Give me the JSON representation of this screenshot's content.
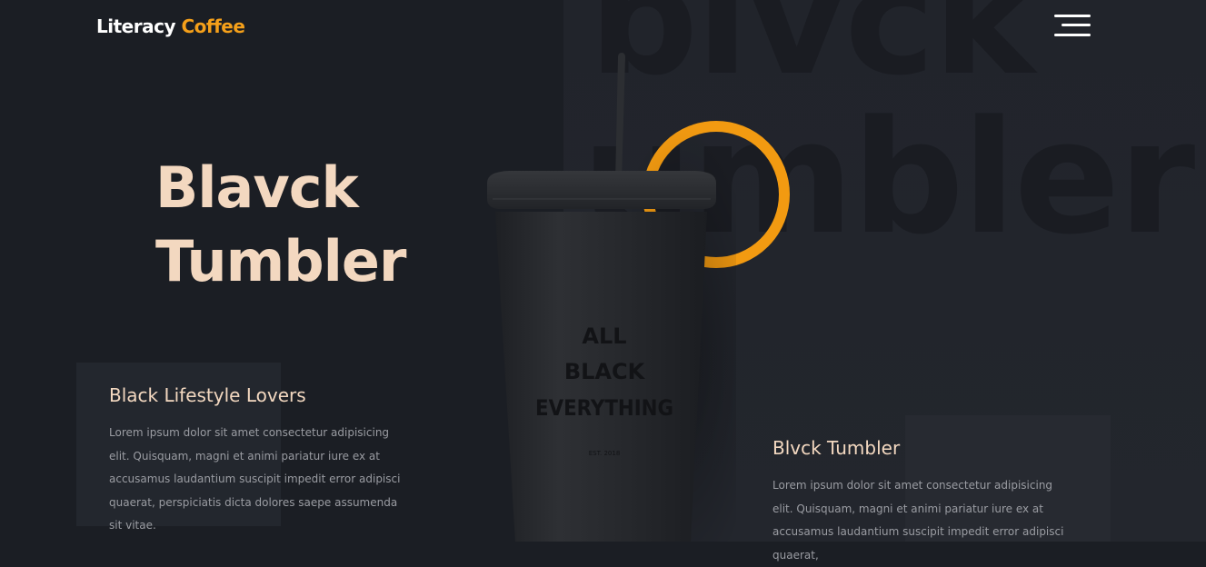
{
  "header": {
    "logo_main": "Literacy",
    "logo_accent": "Coffee"
  },
  "hero": {
    "title_line1": "Blavck",
    "title_line2": "Tumbler",
    "bg_word_line1": "blvck",
    "bg_word_line2": "umbler"
  },
  "product": {
    "print_line1": "ALL",
    "print_line2": "BLACK",
    "print_line3": "EVERYTHING",
    "print_est": "EST. 2018"
  },
  "info_left": {
    "title": "Black Lifestyle Lovers",
    "text": "Lorem ipsum dolor sit amet consectetur adipisicing elit. Quisquam, magni et animi pariatur iure ex at accusamus laudantium suscipit impedit error adipisci quaerat, perspiciatis dicta dolores saepe assumenda sit vitae."
  },
  "info_right": {
    "title": "Blvck Tumbler",
    "text": "Lorem ipsum dolor sit amet consectetur adipisicing elit. Quisquam, magni et animi pariatur iure ex at accusamus laudantium suscipit impedit error adipisci quaerat,"
  },
  "colors": {
    "accent": "#f29a11",
    "title": "#f3d8c0",
    "background": "#1b1e24"
  },
  "icons": {
    "menu": "hamburger-menu-icon"
  }
}
